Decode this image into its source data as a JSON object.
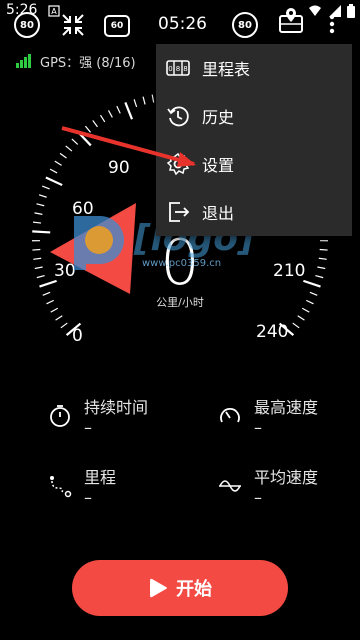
{
  "status_bar": {
    "time": "5:26",
    "notification_glyph": "A"
  },
  "header": {
    "speed_limit_badge_1": "80",
    "speed_limit_badge_2": "60",
    "clock": "05:26",
    "speed_limit_badge_3": "80"
  },
  "gps": {
    "label": "GPS：强 (8/16)"
  },
  "gauge": {
    "tick_labels": [
      "0",
      "30",
      "60",
      "90",
      "210",
      "240"
    ],
    "current_speed": "0",
    "unit": "公里/小时"
  },
  "stats": {
    "duration": {
      "label": "持续时间",
      "value": "–"
    },
    "max_speed": {
      "label": "最高速度",
      "value": "–"
    },
    "distance": {
      "label": "里程",
      "value": "–"
    },
    "avg_speed": {
      "label": "平均速度",
      "value": "–"
    }
  },
  "start_button": {
    "label": "开始"
  },
  "menu": {
    "items": [
      {
        "label": "里程表",
        "icon": "odometer-icon"
      },
      {
        "label": "历史",
        "icon": "history-icon"
      },
      {
        "label": "设置",
        "icon": "settings-icon"
      },
      {
        "label": "退出",
        "icon": "exit-icon"
      }
    ]
  },
  "watermark": {
    "url": "www.pc0359.cn"
  },
  "colors": {
    "accent": "#f34a44",
    "menu_bg": "#2b2b2b",
    "gps_signal": "#2ecc40"
  }
}
